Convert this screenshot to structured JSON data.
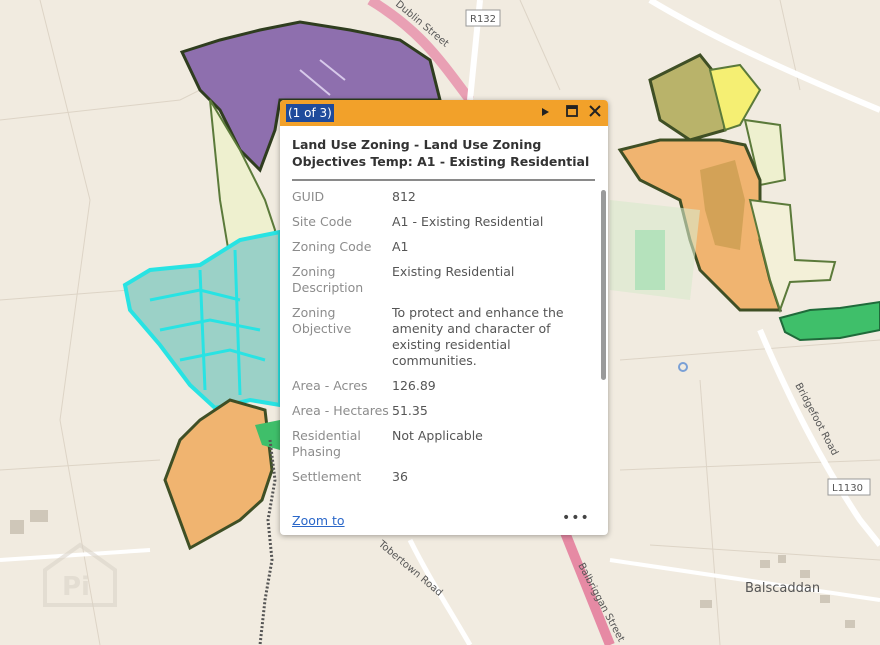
{
  "map": {
    "road_labels": {
      "r132": "R132",
      "l1130": "L1130",
      "bridgefoot": "Bridgefoot Road",
      "balbriggan": "Balbriggan Street",
      "dublin_street": "Dublin Street",
      "tobertown": "Tobertown Road"
    },
    "place_labels": {
      "balscaddan": "Balscaddan"
    },
    "colors": {
      "background": "#f1ebe0",
      "purple_zone": "#8e6fae",
      "orange_zone": "#f0b470",
      "olive_zone": "#b9b36a",
      "yellow_zone": "#f5ef73",
      "cyan_outline": "#28e3e3",
      "green_band": "#3fbf6a",
      "pink_road": "#e68aa4"
    }
  },
  "popup": {
    "pager": "(1 of 3)",
    "icons": {
      "next": "next-feature-icon",
      "maximize": "maximize-icon",
      "close": "close-icon"
    },
    "title": "Land Use Zoning - Land Use Zoning Objectives Temp: A1 - Existing Residential",
    "fields": [
      {
        "name": "GUID",
        "value": "812"
      },
      {
        "name": "Site Code",
        "value": "A1 - Existing Residential"
      },
      {
        "name": "Zoning Code",
        "value": "A1"
      },
      {
        "name": "Zoning Description",
        "value": "Existing Residential"
      },
      {
        "name": "Zoning Objective",
        "value": "To protect and enhance the amenity and character of existing residential communities."
      },
      {
        "name": "Area - Acres",
        "value": "126.89"
      },
      {
        "name": "Area - Hectares",
        "value": "51.35"
      },
      {
        "name": "Residential Phasing",
        "value": "Not Applicable"
      },
      {
        "name": "Settlement",
        "value": "36"
      }
    ],
    "zoom_to": "Zoom to",
    "more": "•••",
    "header_color": "#f2a12a"
  }
}
